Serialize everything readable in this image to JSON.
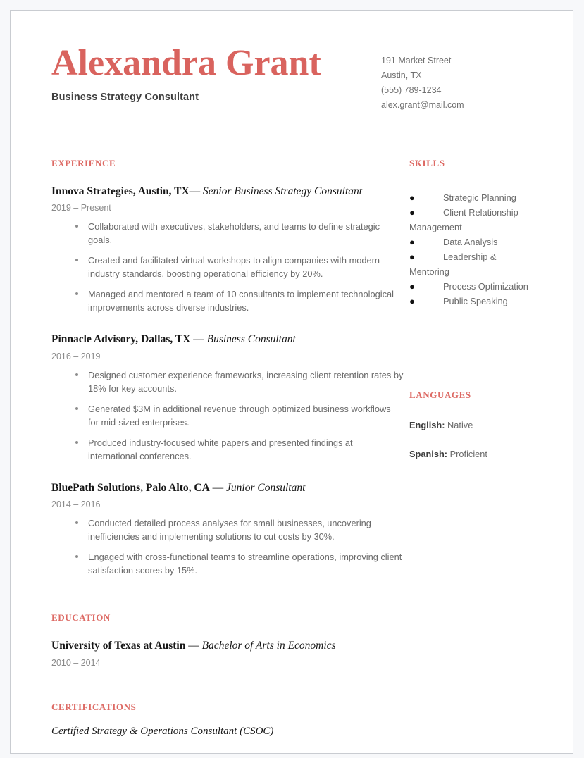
{
  "header": {
    "name": "Alexandra Grant",
    "subtitle": "Business Strategy Consultant",
    "contact": [
      "191 Market Street",
      "Austin, TX",
      "(555) 789-1234",
      "alex.grant@mail.com"
    ]
  },
  "colors": {
    "accent": "#d9635e",
    "heading_accent": "#dd6a64",
    "body_text": "#6a6a6a",
    "dark_text": "#161616",
    "muted_text": "#8a8a8a",
    "page_border": "#c9ccd1",
    "page_background": "#f7f8fa"
  },
  "sections": {
    "experience_heading": "EXPERIENCE",
    "education_heading": "EDUCATION",
    "certifications_heading": "CERTIFICATIONS",
    "skills_heading": "SKILLS",
    "languages_heading": "LANGUAGES"
  },
  "experience": [
    {
      "organization": "Innova Strategies, Austin, TX",
      "separator": "— ",
      "role": "Senior Business Strategy Consultant",
      "dates": "2019 – Present",
      "bullets": [
        "Collaborated with executives, stakeholders, and teams to define strategic goals.",
        "Created and facilitated virtual workshops to align companies with modern industry standards, boosting operational efficiency by 20%.",
        "Managed and mentored a team of 10 consultants to implement technological improvements across diverse industries."
      ]
    },
    {
      "organization": "Pinnacle Advisory, Dallas, TX",
      "separator": " — ",
      "role": "Business Consultant",
      "dates": "2016 – 2019",
      "bullets": [
        "Designed customer experience frameworks, increasing client retention rates by 18% for key accounts.",
        "Generated $3M in additional revenue through optimized business workflows for mid-sized enterprises.",
        "Produced industry-focused white papers and presented findings at international conferences."
      ]
    },
    {
      "organization": "BluePath Solutions, Palo Alto, CA",
      "separator": " — ",
      "role": "Junior Consultant",
      "dates": "2014 – 2016",
      "bullets": [
        "Conducted detailed process analyses for small businesses, uncovering inefficiencies and implementing solutions to cut costs by 30%.",
        "Engaged with cross-functional teams to streamline operations, improving client satisfaction scores by 15%."
      ]
    }
  ],
  "education": {
    "institution": "University of Texas at Austin",
    "separator": " — ",
    "degree": "Bachelor of Arts in Economics",
    "dates": "2010 – 2014"
  },
  "certifications": {
    "items": [
      "Certified Strategy & Operations Consultant (CSOC)"
    ]
  },
  "skills": {
    "bullet_glyph": "●",
    "items": [
      "Strategic Planning",
      "Client Relationship Management",
      "Data Analysis",
      "Leadership & Mentoring",
      "Process Optimization",
      "Public Speaking"
    ]
  },
  "languages": [
    {
      "name": "English:",
      "level": "Native"
    },
    {
      "name": "Spanish:",
      "level": "Proficient"
    }
  ]
}
